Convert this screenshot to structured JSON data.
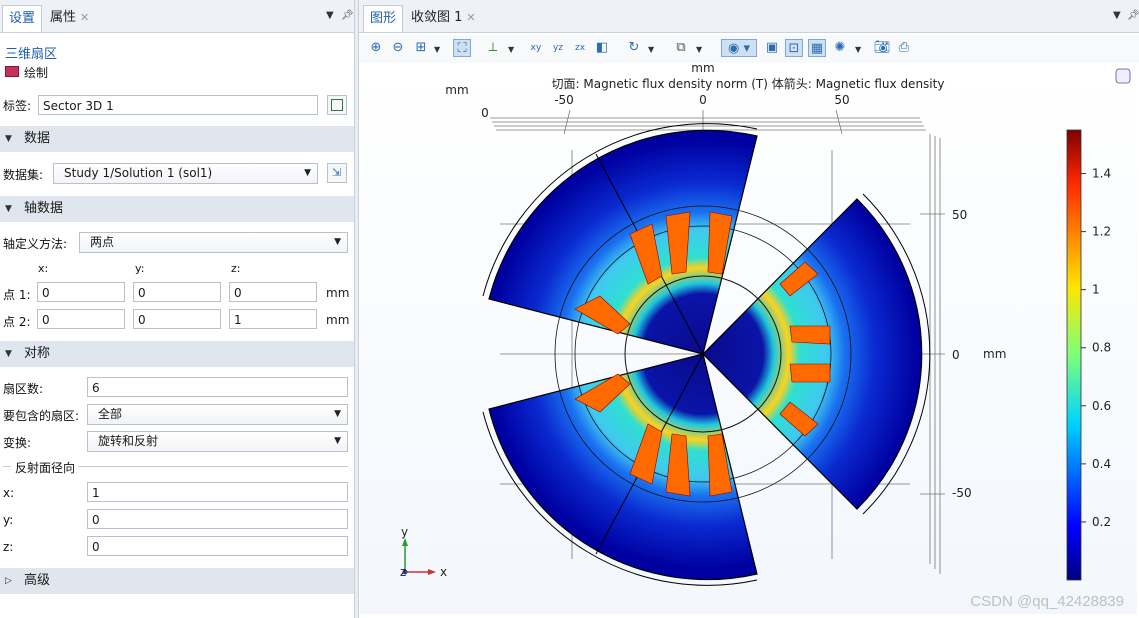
{
  "left_panel": {
    "tabs": [
      {
        "label": "设置"
      },
      {
        "label": "属性"
      }
    ],
    "node_title": "三维扇区",
    "plot_button": "绘制",
    "label_caption": "标签:",
    "label_value": "Sector 3D 1",
    "sections": {
      "data": "数据",
      "axis_data": "轴数据",
      "symmetry": "对称",
      "advanced": "高级"
    },
    "dataset_caption": "数据集:",
    "dataset_value": "Study 1/Solution 1 (sol1)",
    "axis_method_caption": "轴定义方法:",
    "axis_method_value": "两点",
    "col_x": "x:",
    "col_y": "y:",
    "col_z": "z:",
    "point1_caption": "点 1:",
    "point1": {
      "x": "0",
      "y": "0",
      "z": "0"
    },
    "point2_caption": "点 2:",
    "point2": {
      "x": "0",
      "y": "0",
      "z": "1"
    },
    "unit": "mm",
    "sector_count_caption": "扇区数:",
    "sector_count": "6",
    "sectors_include_caption": "要包含的扇区:",
    "sectors_include_value": "全部",
    "transform_caption": "变换:",
    "transform_value": "旋转和反射",
    "reflection_group": "反射面径向",
    "refl_x_caption": "x:",
    "refl_x": "1",
    "refl_y_caption": "y:",
    "refl_y": "0",
    "refl_z_caption": "z:",
    "refl_z": "0"
  },
  "right_panel": {
    "tabs": [
      {
        "label": "图形"
      },
      {
        "label": "收敛图 1"
      }
    ],
    "plot_title": "切面: Magnetic flux density norm (T)  体箭头: Magnetic flux density",
    "axis_unit_top": "mm",
    "axis_unit_left": "mm",
    "axis_unit_right": "mm",
    "x_ticks": [
      "-50",
      "0",
      "50"
    ],
    "y_ticks": [
      "50",
      "0",
      "-50"
    ],
    "top_zero": "0",
    "triad_y": "y",
    "triad_x": "x",
    "triad_z": "z",
    "colorbar_ticks": [
      "1.4",
      "1.2",
      "1",
      "0.8",
      "0.6",
      "0.4",
      "0.2"
    ],
    "watermark": "CSDN @qq_42428839",
    "colors": {
      "accent": "#1f5fa8",
      "tab_bg": "#eef2f7",
      "section_bg": "#dfe6ee"
    }
  },
  "chart_data": {
    "type": "heatmap",
    "title": "切面: Magnetic flux density norm (T)  体箭头: Magnetic flux density",
    "xlabel": "mm",
    "ylabel": "mm",
    "x_ticks": [
      -50,
      0,
      50
    ],
    "y_ticks": [
      50,
      0,
      -50
    ],
    "colorbar": {
      "min": 0,
      "max": 1.55,
      "ticks": [
        0.2,
        0.4,
        0.6,
        0.8,
        1,
        1.2,
        1.4
      ],
      "colormap": "jet"
    },
    "sectors_shown": 3,
    "sector_angle_deg": 60
  }
}
